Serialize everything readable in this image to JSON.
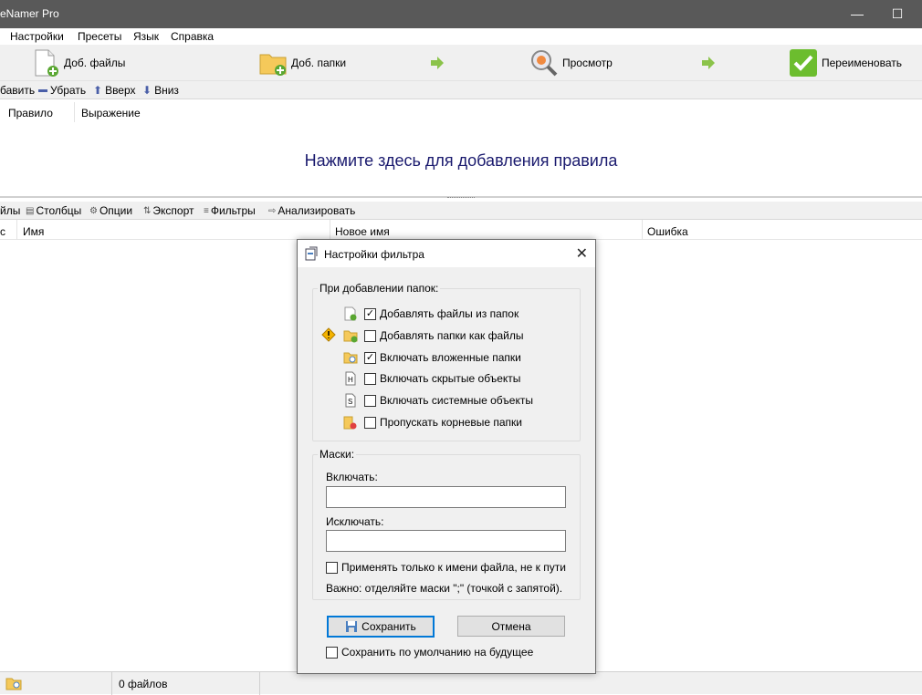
{
  "window": {
    "title": "eNamer Pro",
    "min": "—",
    "max": "☐"
  },
  "menu": [
    "Настройки",
    "Пресеты",
    "Язык",
    "Справка"
  ],
  "toolbar": {
    "add_files": "Доб. файлы",
    "add_folders": "Доб. папки",
    "preview": "Просмотр",
    "rename": "Переименовать"
  },
  "rulebar": {
    "add": "бавить",
    "remove": "Убрать",
    "up": "Вверх",
    "down": "Вниз"
  },
  "rules": {
    "col_rule": "Правило",
    "col_expr": "Выражение",
    "empty_hint": "Нажмите здесь для добавления правила"
  },
  "filebar": {
    "files": "йлы",
    "columns": "Столбцы",
    "options": "Опции",
    "export": "Экспорт",
    "filters": "Фильтры",
    "analyze": "Анализировать"
  },
  "files": {
    "col_status": "с",
    "col_name": "Имя",
    "col_new_name": "Новое имя",
    "col_error": "Ошибка"
  },
  "status": {
    "count": "0 файлов"
  },
  "dialog": {
    "title": "Настройки фильтра",
    "close": "✕",
    "folders_group": "При добавлении папок:",
    "options": [
      {
        "label": "Добавлять файлы из папок",
        "checked": true,
        "icon": "file-add-icon"
      },
      {
        "label": "Добавлять папки как файлы",
        "checked": false,
        "icon": "folder-add-icon"
      },
      {
        "label": "Включать вложенные папки",
        "checked": true,
        "icon": "folder-search-icon"
      },
      {
        "label": "Включать скрытые объекты",
        "checked": false,
        "icon": "hidden-file-icon"
      },
      {
        "label": "Включать системные объекты",
        "checked": false,
        "icon": "system-file-icon"
      },
      {
        "label": "Пропускать корневые папки",
        "checked": false,
        "icon": "folder-skip-icon"
      }
    ],
    "masks_group": "Маски:",
    "include_label": "Включать:",
    "include_value": "",
    "exclude_label": "Исключать:",
    "exclude_value": "",
    "filename_only": "Применять только к имени файла, не к пути",
    "filename_only_checked": false,
    "note": "Важно: отделяйте маски \";\" (точкой с запятой).",
    "save": "Сохранить",
    "cancel": "Отмена",
    "save_default": "Сохранить по умолчанию на будущее",
    "save_default_checked": false
  }
}
